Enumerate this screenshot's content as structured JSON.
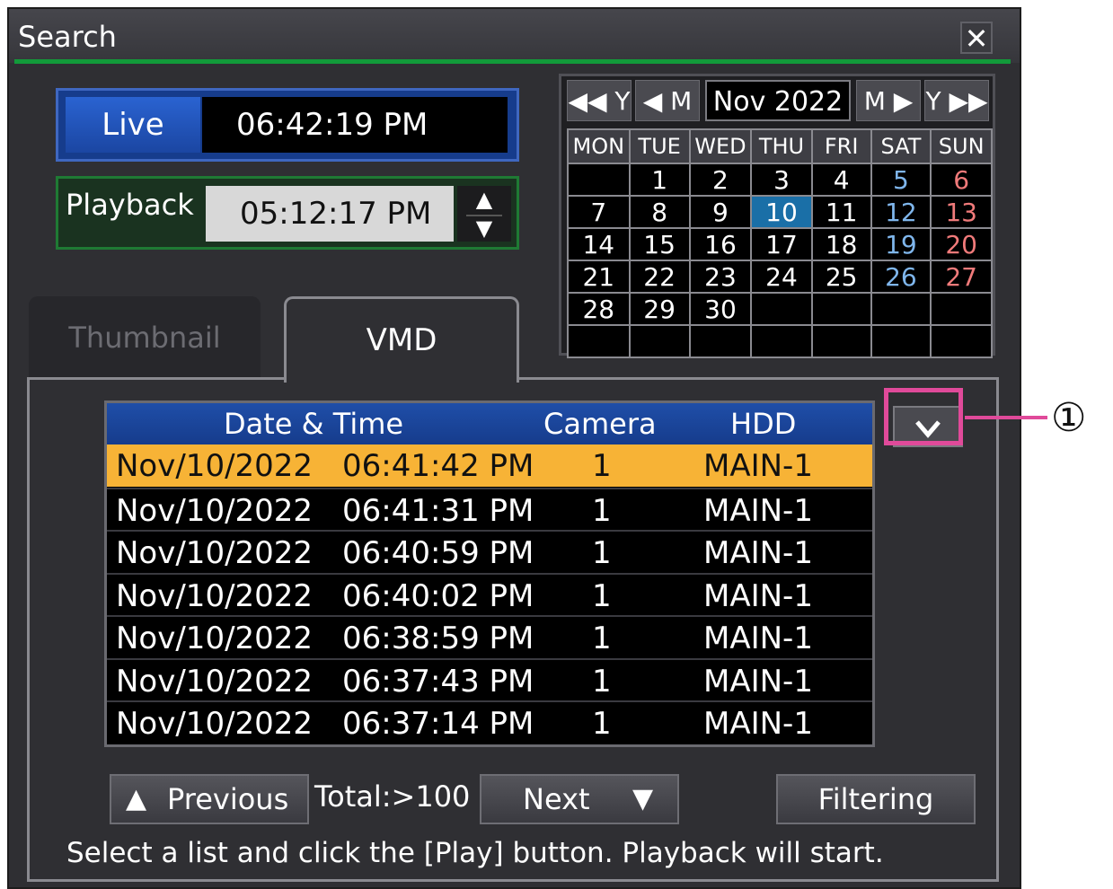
{
  "window": {
    "title": "Search",
    "close_glyph": "✕"
  },
  "live": {
    "label": "Live",
    "time": "06:42:19 PM"
  },
  "playback": {
    "label": "Playback",
    "time": "05:12:17 PM"
  },
  "calendar": {
    "month": "Nov 2022",
    "nav": {
      "prev_year": "◀◀ Y",
      "prev_month": "◀ M",
      "next_month": "M ▶",
      "next_year": "Y ▶▶"
    },
    "weekdays": [
      "MON",
      "TUE",
      "WED",
      "THU",
      "FRI",
      "SAT",
      "SUN"
    ],
    "weeks": [
      [
        "",
        "1",
        "2",
        "3",
        "4",
        "5",
        "6"
      ],
      [
        "7",
        "8",
        "9",
        "10",
        "11",
        "12",
        "13"
      ],
      [
        "14",
        "15",
        "16",
        "17",
        "18",
        "19",
        "20"
      ],
      [
        "21",
        "22",
        "23",
        "24",
        "25",
        "26",
        "27"
      ],
      [
        "28",
        "29",
        "30",
        "",
        "",
        "",
        ""
      ],
      [
        "",
        "",
        "",
        "",
        "",
        "",
        ""
      ]
    ],
    "selected_day": "10",
    "colors": {
      "saturday": "#7fb6ec",
      "sunday": "#f07a7a",
      "selected": "#1a6fa7"
    }
  },
  "tabs": {
    "thumbnail": "Thumbnail",
    "vmd": "VMD",
    "active": "VMD"
  },
  "list": {
    "headers": {
      "datetime": "Date & Time",
      "camera": "Camera",
      "hdd": "HDD"
    },
    "rows": [
      {
        "date": "Nov/10/2022",
        "time": "06:41:42 PM",
        "camera": "1",
        "hdd": "MAIN-1",
        "selected": true
      },
      {
        "date": "Nov/10/2022",
        "time": "06:41:31 PM",
        "camera": "1",
        "hdd": "MAIN-1",
        "selected": false
      },
      {
        "date": "Nov/10/2022",
        "time": "06:40:59 PM",
        "camera": "1",
        "hdd": "MAIN-1",
        "selected": false
      },
      {
        "date": "Nov/10/2022",
        "time": "06:40:02 PM",
        "camera": "1",
        "hdd": "MAIN-1",
        "selected": false
      },
      {
        "date": "Nov/10/2022",
        "time": "06:38:59 PM",
        "camera": "1",
        "hdd": "MAIN-1",
        "selected": false
      },
      {
        "date": "Nov/10/2022",
        "time": "06:37:43 PM",
        "camera": "1",
        "hdd": "MAIN-1",
        "selected": false
      },
      {
        "date": "Nov/10/2022",
        "time": "06:37:14 PM",
        "camera": "1",
        "hdd": "MAIN-1",
        "selected": false
      }
    ],
    "selected_color": "#f7b336"
  },
  "dropdown_icon": "chevron-down-icon",
  "callout": {
    "number": "①",
    "color": "#e04a9a"
  },
  "footer": {
    "previous": "Previous",
    "total": "Total:>100",
    "next": "Next",
    "filtering": "Filtering",
    "hint": "Select a list and click the [Play] button. Playback will start."
  },
  "colors": {
    "accent_green": "#129a3a",
    "live_blue": "#1b46a2",
    "header_blue": "#1f4ea8"
  }
}
